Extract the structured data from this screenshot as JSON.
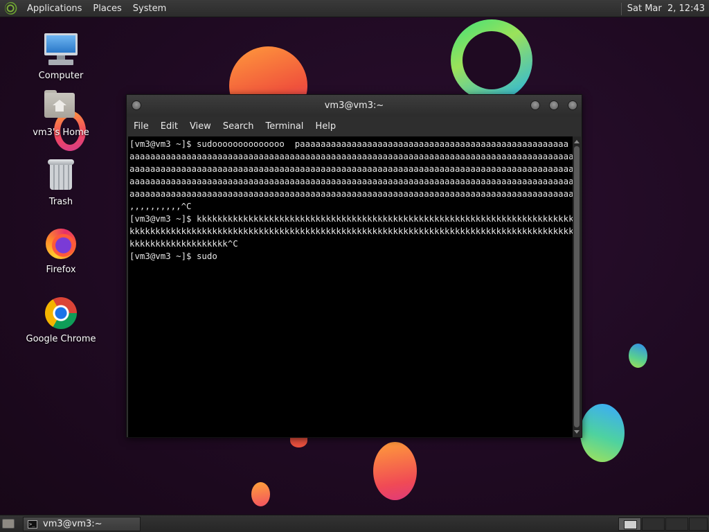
{
  "top_panel": {
    "menus": [
      "Applications",
      "Places",
      "System"
    ],
    "clock": "Sat Mar  2, 12:43",
    "logo_icon": "gnome-foot-icon"
  },
  "desktop_icons": [
    {
      "label": "Computer",
      "icon": "computer-icon"
    },
    {
      "label": "vm3's Home",
      "icon": "home-folder-icon"
    },
    {
      "label": "Trash",
      "icon": "trash-icon"
    },
    {
      "label": "Firefox",
      "icon": "firefox-icon"
    },
    {
      "label": "Google Chrome",
      "icon": "chrome-icon"
    }
  ],
  "terminal": {
    "title": "vm3@vm3:~",
    "menu": [
      "File",
      "Edit",
      "View",
      "Search",
      "Terminal",
      "Help"
    ],
    "lines": [
      "[vm3@vm3 ~]$ sudoooooooooooooo  paaaaaaaaaaaaaaaaaaaaaaaaaaaaaaaaaaaaaaaaaaaaaaaaaaaa",
      "aaaaaaaaaaaaaaaaaaaaaaaaaaaaaaaaaaaaaaaaaaaaaaaaaaaaaaaaaaaaaaaaaaaaaaaaaaaaaaaaaaaaaaaa",
      "aaaaaaaaaaaaaaaaaaaaaaaaaaaaaaaaaaaaaaaaaaaaaaaaaaaaaaaaaaaaaaaaaaaaaaaaaaaaaaaaaaaaaaaa",
      "aaaaaaaaaaaaaaaaaaaaaaaaaaaaaaaaaaaaaaaaaaaaaaaaaaaaaaaaaaaaaaaaaaaaaaaaaaaaaaaaaaaaaaaa",
      "aaaaaaaaaaaaaaaaaaaaaaaaaaaaaaaaaaaaaaaaaaaaaaaaaaaaaaaaaaaaaaaaaaaaaaaaaaaaaaaaaaaaaa,",
      ",,,,,,,,,,^C",
      "[vm3@vm3 ~]$ kkkkkkkkkkkkkkkkkkkkkkkkkkkkkkkkkkkkkkkkkkkkkkkkkkkkkkkkkkkkkkkkkkkkkkkkkk",
      "kkkkkkkkkkkkkkkkkkkkkkkkkkkkkkkkkkkkkkkkkkkkkkkkkkkkkkkkkkkkkkkkkkkkkkkkkkkkkkkkkkkkkkkk",
      "kkkkkkkkkkkkkkkkkkk^C",
      "[vm3@vm3 ~]$ sudo"
    ]
  },
  "taskbar": {
    "window_button": "vm3@vm3:~",
    "workspaces": 4,
    "active_workspace": 1
  }
}
